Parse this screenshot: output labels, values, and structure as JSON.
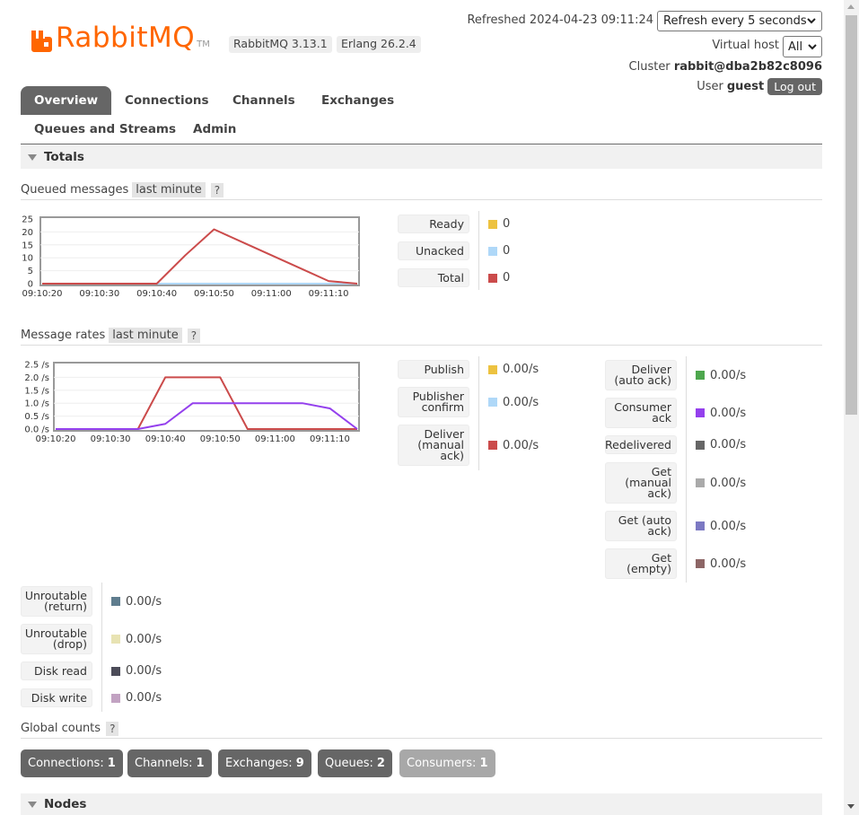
{
  "header": {
    "brand": "RabbitMQ",
    "tm": "TM",
    "version": "RabbitMQ 3.13.1",
    "erlang": "Erlang 26.2.4",
    "refreshed": "Refreshed 2024-04-23 09:11:24",
    "refresh_select": "Refresh every 5 seconds",
    "vhost_label": "Virtual host",
    "vhost_select": "All",
    "cluster_label": "Cluster",
    "cluster_name": "rabbit@dba2b82c8096",
    "user_label": "User",
    "user_name": "guest",
    "logout": "Log out"
  },
  "tabs": [
    "Overview",
    "Connections",
    "Channels",
    "Exchanges",
    "Queues and Streams",
    "Admin"
  ],
  "totals": {
    "title": "Totals",
    "queued_title": "Queued messages",
    "range": "last minute",
    "help": "?",
    "queued_stats": [
      {
        "label": "Ready",
        "value": "0",
        "color": "#edc240"
      },
      {
        "label": "Unacked",
        "value": "0",
        "color": "#afd8f8"
      },
      {
        "label": "Total",
        "value": "0",
        "color": "#cb4b4b"
      }
    ],
    "rates_title": "Message rates",
    "rates_left": [
      {
        "label": "Publish",
        "value": "0.00/s",
        "color": "#edc240"
      },
      {
        "label": "Publisher confirm",
        "value": "0.00/s",
        "color": "#afd8f8"
      },
      {
        "label": "Deliver (manual ack)",
        "value": "0.00/s",
        "color": "#cb4b4b"
      }
    ],
    "rates_right": [
      {
        "label": "Deliver (auto ack)",
        "value": "0.00/s",
        "color": "#4da74d"
      },
      {
        "label": "Consumer ack",
        "value": "0.00/s",
        "color": "#9440ed"
      },
      {
        "label": "Redelivered",
        "value": "0.00/s",
        "color": "#666666"
      },
      {
        "label": "Get (manual ack)",
        "value": "0.00/s",
        "color": "#aaaaaa"
      },
      {
        "label": "Get (auto ack)",
        "value": "0.00/s",
        "color": "#7c79c3"
      },
      {
        "label": "Get (empty)",
        "value": "0.00/s",
        "color": "#8d6666"
      }
    ],
    "rates_bottom": [
      {
        "label": "Unroutable (return)",
        "value": "0.00/s",
        "color": "#5f7d8e"
      },
      {
        "label": "Unroutable (drop)",
        "value": "0.00/s",
        "color": "#e8e3b3"
      },
      {
        "label": "Disk read",
        "value": "0.00/s",
        "color": "#4c4c59"
      },
      {
        "label": "Disk write",
        "value": "0.00/s",
        "color": "#c2a2c2"
      }
    ],
    "global_title": "Global counts",
    "global_counts": [
      {
        "label": "Connections:",
        "value": "1"
      },
      {
        "label": "Channels:",
        "value": "1"
      },
      {
        "label": "Exchanges:",
        "value": "9"
      },
      {
        "label": "Queues:",
        "value": "2"
      },
      {
        "label": "Consumers:",
        "value": "1"
      }
    ]
  },
  "nodes": {
    "title": "Nodes"
  },
  "chart_data": [
    {
      "type": "line",
      "title": "Queued messages",
      "x": [
        "09:10:20",
        "09:10:25",
        "09:10:30",
        "09:10:35",
        "09:10:40",
        "09:10:45",
        "09:10:50",
        "09:10:55",
        "09:11:00",
        "09:11:05",
        "09:11:10",
        "09:11:15"
      ],
      "x_ticks": [
        "09:10:20",
        "09:10:30",
        "09:10:40",
        "09:10:50",
        "09:11:00",
        "09:11:10"
      ],
      "y_ticks": [
        "25",
        "20",
        "15",
        "10",
        "5",
        "0"
      ],
      "ylim": [
        0,
        25
      ],
      "series": [
        {
          "name": "Ready",
          "color": "#edc240",
          "values": [
            0,
            0,
            0,
            0,
            0,
            0,
            0,
            0,
            0,
            0,
            0,
            0
          ]
        },
        {
          "name": "Unacked",
          "color": "#afd8f8",
          "values": [
            0,
            0,
            0,
            0,
            0,
            0,
            0,
            0,
            0,
            0,
            0,
            0
          ]
        },
        {
          "name": "Total",
          "color": "#cb4b4b",
          "values": [
            0,
            0,
            0,
            0,
            0,
            11,
            21,
            16,
            11,
            6,
            1,
            0
          ]
        }
      ]
    },
    {
      "type": "line",
      "title": "Message rates",
      "x": [
        "09:10:20",
        "09:10:25",
        "09:10:30",
        "09:10:35",
        "09:10:40",
        "09:10:45",
        "09:10:50",
        "09:10:55",
        "09:11:00",
        "09:11:05",
        "09:11:10",
        "09:11:15"
      ],
      "x_ticks": [
        "09:10:20",
        "09:10:30",
        "09:10:40",
        "09:10:50",
        "09:11:00",
        "09:11:10"
      ],
      "y_ticks": [
        "2.5 /s",
        "2.0 /s",
        "1.5 /s",
        "1.0 /s",
        "0.5 /s",
        "0.0 /s"
      ],
      "ylim": [
        0,
        2.5
      ],
      "series": [
        {
          "name": "Deliver (manual ack)",
          "color": "#cb4b4b",
          "values": [
            0,
            0,
            0,
            0,
            2.0,
            2.0,
            2.0,
            0,
            0,
            0,
            0,
            0
          ]
        },
        {
          "name": "Consumer ack",
          "color": "#9440ed",
          "values": [
            0,
            0,
            0,
            0,
            0.2,
            1.0,
            1.0,
            1.0,
            1.0,
            1.0,
            0.8,
            0
          ]
        }
      ]
    }
  ]
}
